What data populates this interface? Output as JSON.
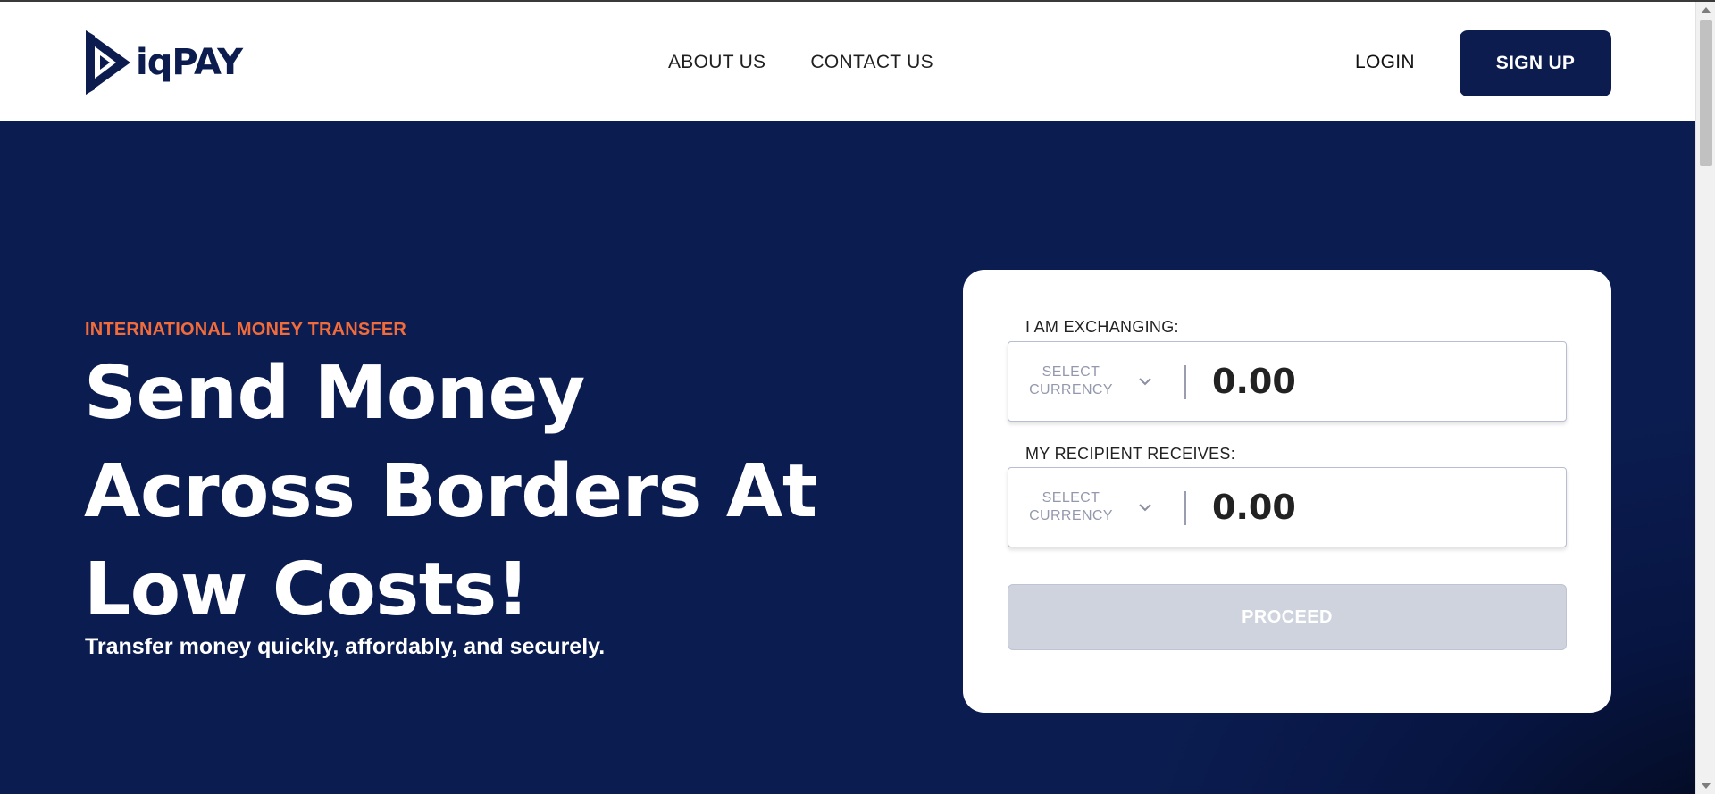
{
  "brand": {
    "name": "iqPAY",
    "color": "#0c1c4f"
  },
  "nav": {
    "items": [
      {
        "label": "ABOUT US"
      },
      {
        "label": "CONTACT US"
      }
    ]
  },
  "auth": {
    "login_label": "LOGIN",
    "signup_label": "SIGN UP"
  },
  "hero": {
    "eyebrow": "INTERNATIONAL MONEY TRANSFER",
    "headline_lines": [
      "Send Money",
      "Across Borders At",
      "Low Costs!"
    ],
    "subline": "Transfer money quickly, affordably, and securely.",
    "accent_color": "#f26b3a",
    "background_color": "#0b1c50"
  },
  "exchange": {
    "send": {
      "label": "I AM EXCHANGING:",
      "currency_line1": "SELECT",
      "currency_line2": "CURRENCY",
      "amount": "0.00"
    },
    "receive": {
      "label": "MY RECIPIENT RECEIVES:",
      "currency_line1": "SELECT",
      "currency_line2": "CURRENCY",
      "amount": "0.00"
    },
    "proceed_label": "PROCEED",
    "proceed_disabled_color": "#cfd3de"
  },
  "icons": {
    "logo": "iqpay-logo-icon",
    "chevron": "chevron-down-icon"
  }
}
